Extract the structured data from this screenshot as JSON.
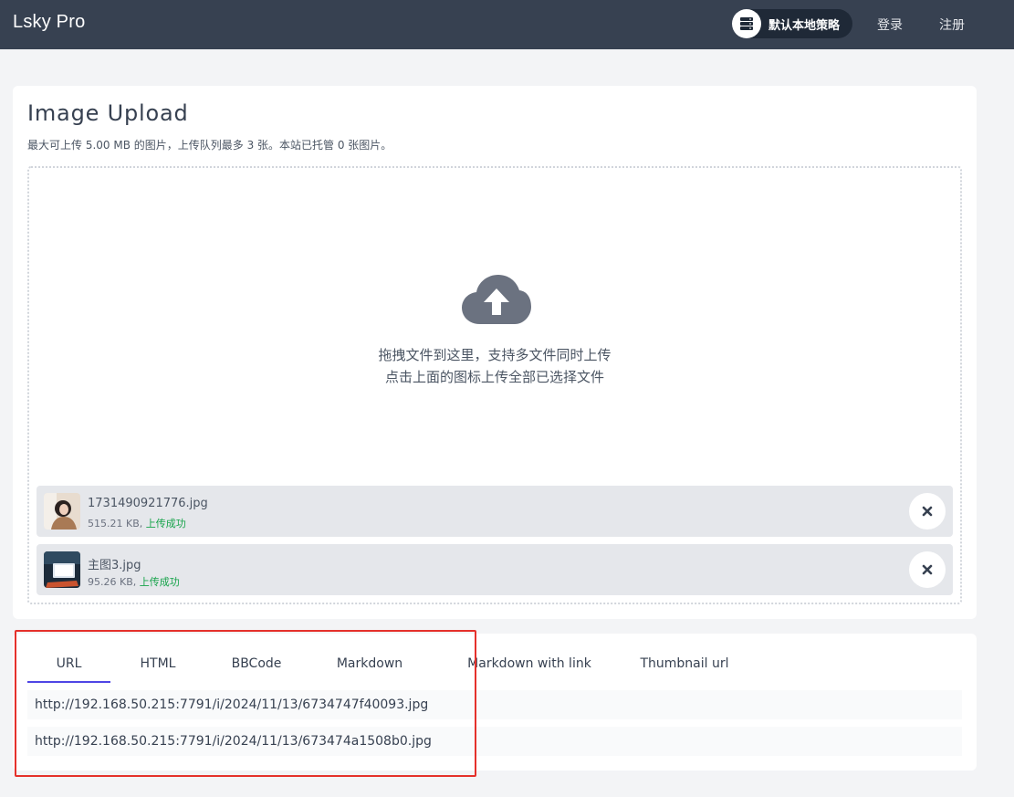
{
  "header": {
    "brand": "Lsky Pro",
    "strategy_label": "默认本地策略",
    "login": "登录",
    "register": "注册"
  },
  "upload": {
    "title": "Image Upload",
    "subtitle": "最大可上传 5.00 MB 的图片，上传队列最多 3 张。本站已托管 0 张图片。",
    "drop_line_1": "拖拽文件到这里，支持多文件同时上传",
    "drop_line_2": "点击上面的图标上传全部已选择文件",
    "files": [
      {
        "name": "1731490921776.jpg",
        "size": "515.21 KB,",
        "status": "上传成功"
      },
      {
        "name": "主图3.jpg",
        "size": "95.26 KB,",
        "status": "上传成功"
      }
    ]
  },
  "links": {
    "tabs": [
      "URL",
      "HTML",
      "BBCode",
      "Markdown",
      "Markdown with link",
      "Thumbnail url"
    ],
    "active_tab": "URL",
    "rows": [
      "http://192.168.50.215:7791/i/2024/11/13/6734747f40093.jpg",
      "http://192.168.50.215:7791/i/2024/11/13/673474a1508b0.jpg"
    ]
  },
  "colors": {
    "header_bg": "#374151",
    "page_bg": "#f3f4f6",
    "active_tab": "#4f46e5",
    "success": "#16a34a",
    "annotation": "#e5312b"
  }
}
